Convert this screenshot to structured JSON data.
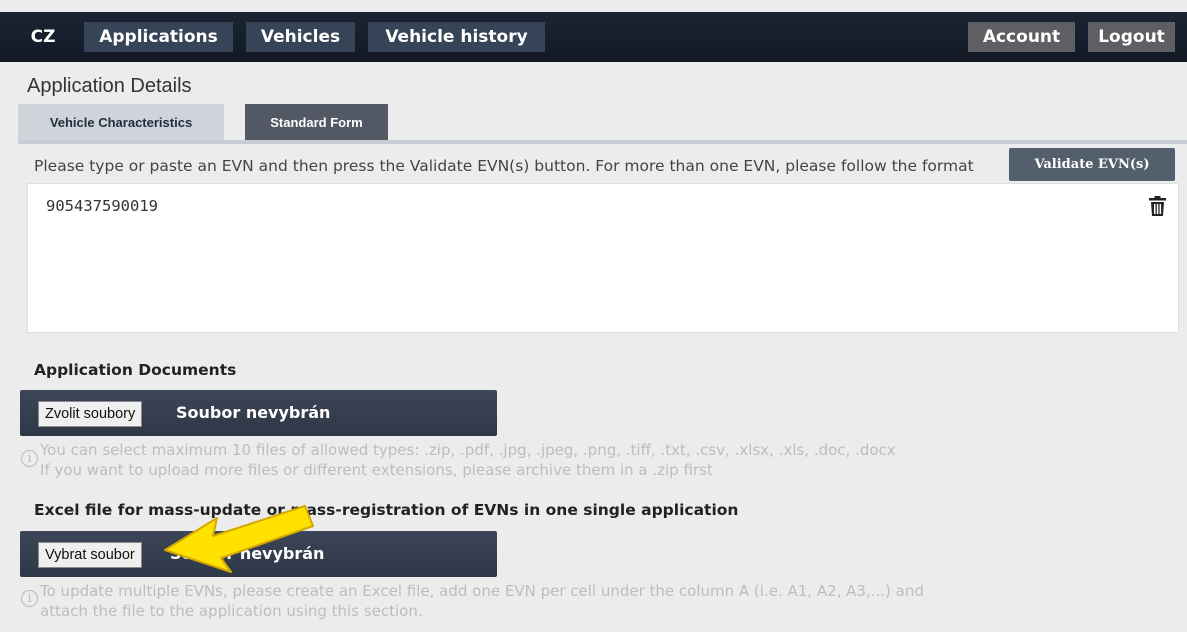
{
  "nav": {
    "country": "CZ",
    "applications": "Applications",
    "vehicles": "Vehicles",
    "vehicle_history": "Vehicle history",
    "account": "Account",
    "logout": "Logout"
  },
  "page": {
    "title": "Application Details",
    "tabs": [
      "Vehicle Characteristics",
      "Standard Form"
    ]
  },
  "evn": {
    "instructions": "Please type or paste an EVN and then press the Validate EVN(s) button. For more than one EVN, please follow the format",
    "validate_label": "Validate EVN(s)",
    "value": "905437590019",
    "delete_icon": "trash-icon"
  },
  "documents": {
    "heading": "Application Documents",
    "choose_label": "Zvolit soubory",
    "status": "Soubor nevybrán",
    "help_line1": "You can select maximum 10 files of allowed types: .zip, .pdf, .jpg, .jpeg, .png, .tiff, .txt, .csv, .xlsx, .xls, .doc, .docx",
    "help_line2": "If you want to upload more files or different extensions, please archive them in a .zip first"
  },
  "excel": {
    "heading": "Excel file for mass-update or mass-registration of EVNs in one single application",
    "choose_label": "Vybrat soubor",
    "status": "Soubor nevybrán",
    "help_line1": "To update multiple EVNs, please create an Excel file, add one EVN per cell under the column A (i.e. A1, A2, A3,...) and",
    "help_line2": "attach the file to the application using this section."
  },
  "colors": {
    "nav_bg": "#121925",
    "nav_button": "#374457",
    "highlight_arrow": "#ffe200"
  }
}
